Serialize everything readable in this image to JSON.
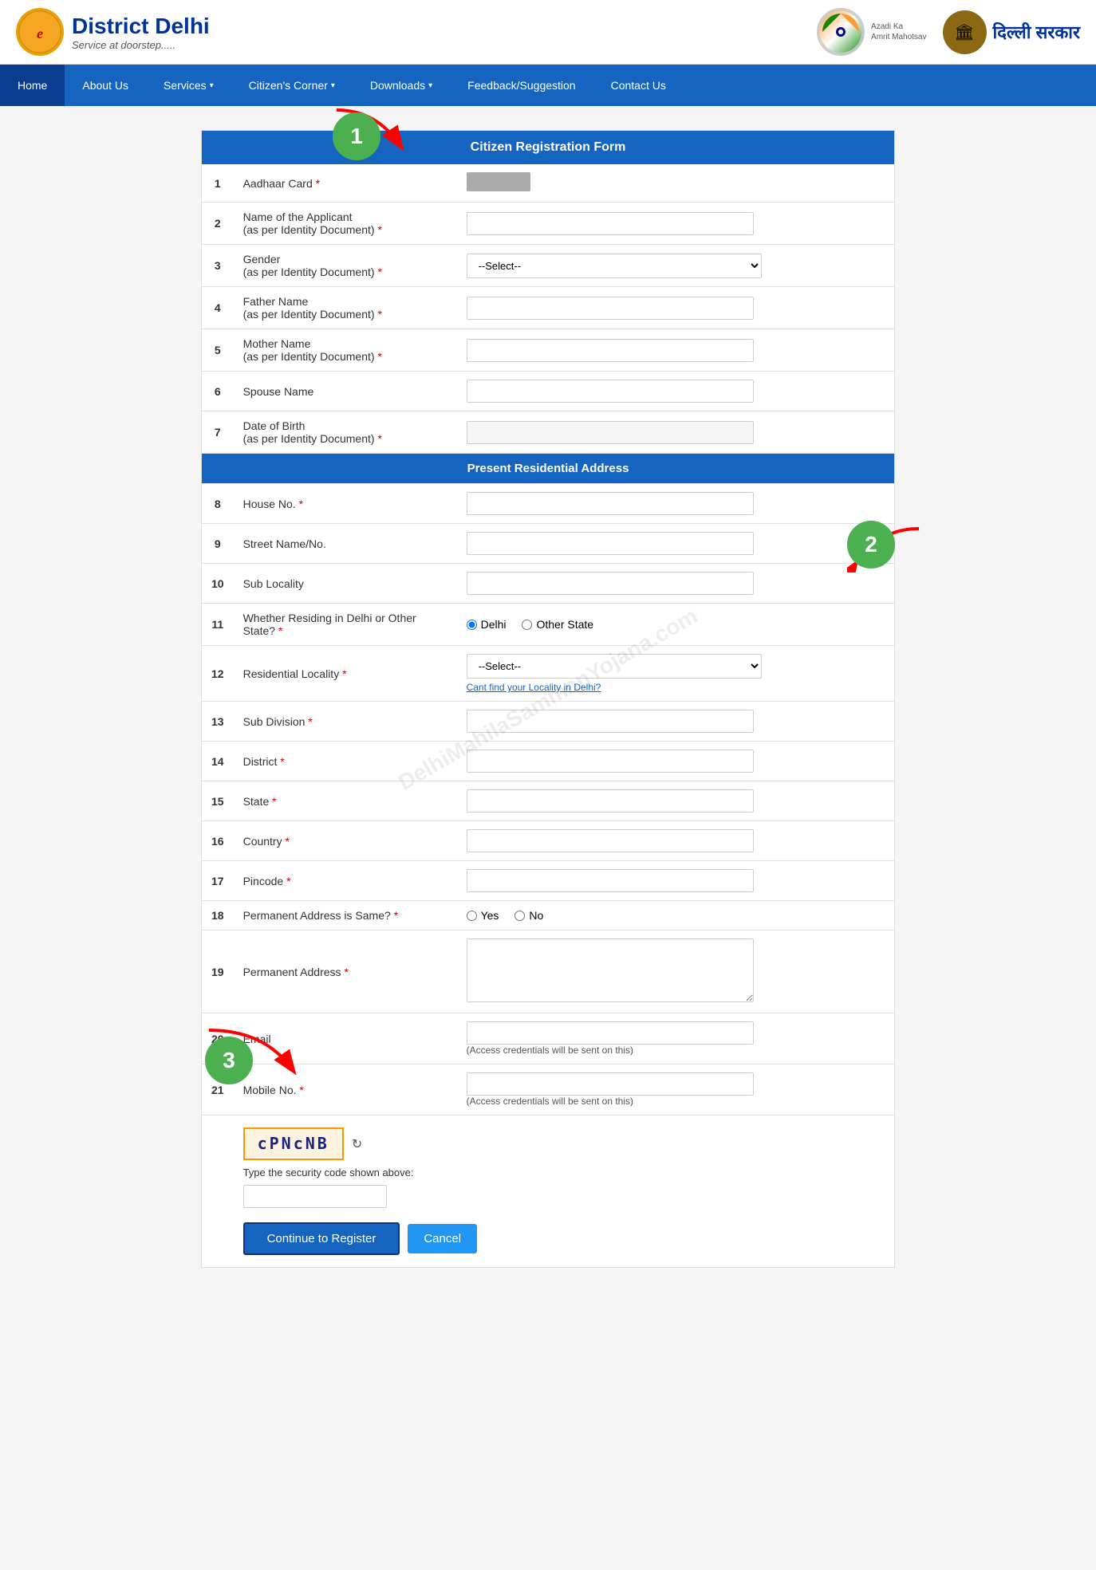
{
  "header": {
    "logo_title": "District Delhi",
    "logo_subtitle": "Service at doorstep.....",
    "azadi_label": "Azadi Ka\nAmrit Mahotsav",
    "delhi_sarkar_label": "दिल्ली सरकार"
  },
  "navbar": {
    "home": "Home",
    "about_us": "About Us",
    "services": "Services",
    "citizens_corner": "Citizen's Corner",
    "downloads": "Downloads",
    "feedback": "Feedback/Suggestion",
    "contact_us": "Contact Us"
  },
  "form": {
    "title": "Citizen Registration Form",
    "section2_title": "Present Residential Address",
    "rows": [
      {
        "num": "1",
        "label": "Aadhaar Card",
        "required": true,
        "type": "masked"
      },
      {
        "num": "2",
        "label": "Name of the Applicant\n(as per Identity Document)",
        "required": true,
        "type": "text"
      },
      {
        "num": "3",
        "label": "Gender\n(as per Identity Document)",
        "required": true,
        "type": "select",
        "placeholder": "--Select--"
      },
      {
        "num": "4",
        "label": "Father Name\n(as per Identity Document)",
        "required": true,
        "type": "text"
      },
      {
        "num": "5",
        "label": "Mother Name\n(as per Identity Document)",
        "required": true,
        "type": "text"
      },
      {
        "num": "6",
        "label": "Spouse Name",
        "required": false,
        "type": "text"
      },
      {
        "num": "7",
        "label": "Date of Birth\n(as per Identity Document)",
        "required": true,
        "type": "date"
      },
      {
        "num": "8",
        "label": "House No.",
        "required": true,
        "type": "text"
      },
      {
        "num": "9",
        "label": "Street Name/No.",
        "required": false,
        "type": "text"
      },
      {
        "num": "10",
        "label": "Sub Locality",
        "required": false,
        "type": "text"
      },
      {
        "num": "11",
        "label": "Whether Residing in Delhi or Other State?",
        "required": true,
        "type": "radio",
        "options": [
          "Delhi",
          "Other State"
        ]
      },
      {
        "num": "12",
        "label": "Residential Locality",
        "required": true,
        "type": "select_locality",
        "placeholder": "--Select--",
        "help": "Cant find your Locality in Delhi?"
      },
      {
        "num": "13",
        "label": "Sub Division",
        "required": true,
        "type": "text"
      },
      {
        "num": "14",
        "label": "District",
        "required": true,
        "type": "text"
      },
      {
        "num": "15",
        "label": "State",
        "required": true,
        "type": "text"
      },
      {
        "num": "16",
        "label": "Country",
        "required": true,
        "type": "text"
      },
      {
        "num": "17",
        "label": "Pincode",
        "required": true,
        "type": "text"
      },
      {
        "num": "18",
        "label": "Permanent Address is Same?",
        "required": true,
        "type": "radio_yn",
        "options": [
          "Yes",
          "No"
        ]
      },
      {
        "num": "19",
        "label": "Permanent Address",
        "required": true,
        "type": "textarea"
      },
      {
        "num": "20",
        "label": "Email",
        "required": false,
        "type": "email",
        "hint": "(Access credentials will be sent on this)"
      },
      {
        "num": "21",
        "label": "Mobile No.",
        "required": true,
        "type": "mobile",
        "hint": "(Access credentials will be sent on this)"
      }
    ],
    "captcha_text": "cPNcNB",
    "captcha_label": "Type the security code shown above:",
    "btn_continue": "Continue to Register",
    "btn_cancel": "Cancel"
  },
  "annotations": {
    "circle1": "1",
    "circle2": "2",
    "circle3": "3"
  },
  "watermark": "DelhiMahilaSammanYojana.com"
}
